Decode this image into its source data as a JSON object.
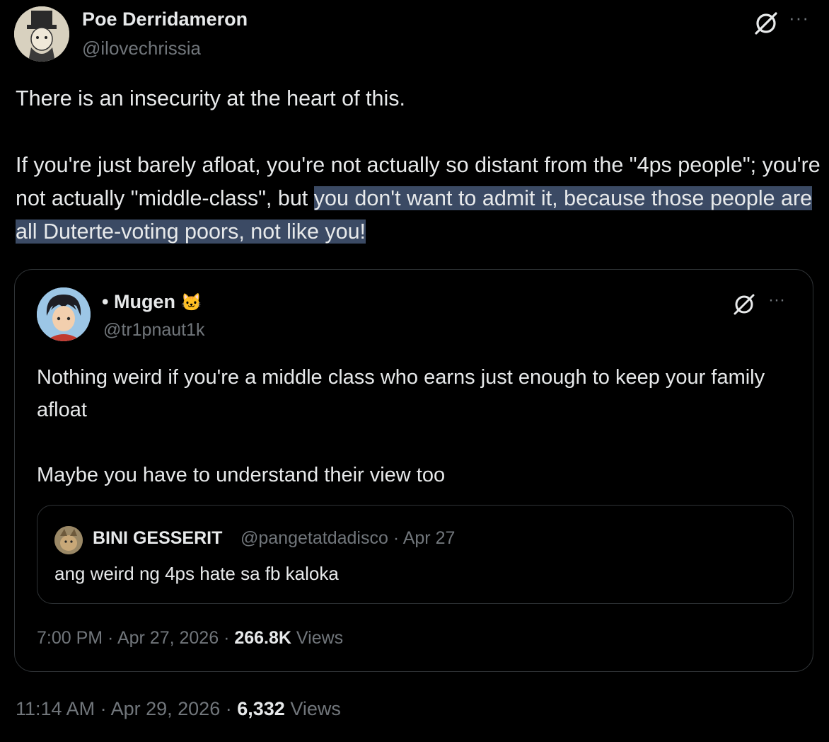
{
  "main_tweet": {
    "author_name": "Poe Derridameron",
    "handle": "@ilovechrissia",
    "text_p1": "There is an insecurity at the heart of this.",
    "text_p2_plain": "If you're just barely afloat, you're not actually so distant from the \"4ps people\"; you're not actually \"middle-class\", but",
    "text_p2_highlight": "you don't want to admit it, because those people are all Duterte-voting poors, not like you!",
    "time": "11:14 AM",
    "date": "Apr 29, 2026",
    "views_count": "6,332",
    "views_label": "Views",
    "icons": [
      "grok-icon",
      "more-icon"
    ]
  },
  "quoted_tweet": {
    "author_name": "• Mugen",
    "author_emoji": "🐱",
    "handle": "@tr1pnaut1k",
    "text_p1": "Nothing weird if you're a middle class who earns just enough to keep your family afloat",
    "text_p2": "Maybe you have to understand their view too",
    "time": "7:00 PM",
    "date": "Apr 27, 2026",
    "views_count": "266.8K",
    "views_label": "Views"
  },
  "nested_quote": {
    "author_name": "BINI GESSERIT",
    "handle": "@pangetatdadisco",
    "date": "Apr 27",
    "text": "ang weird ng 4ps hate sa fb kaloka"
  },
  "colors": {
    "background": "#000000",
    "primary_text": "#e7e9ea",
    "secondary_text": "#71767b",
    "border": "#2f3336",
    "highlight": "#3b4a64"
  }
}
